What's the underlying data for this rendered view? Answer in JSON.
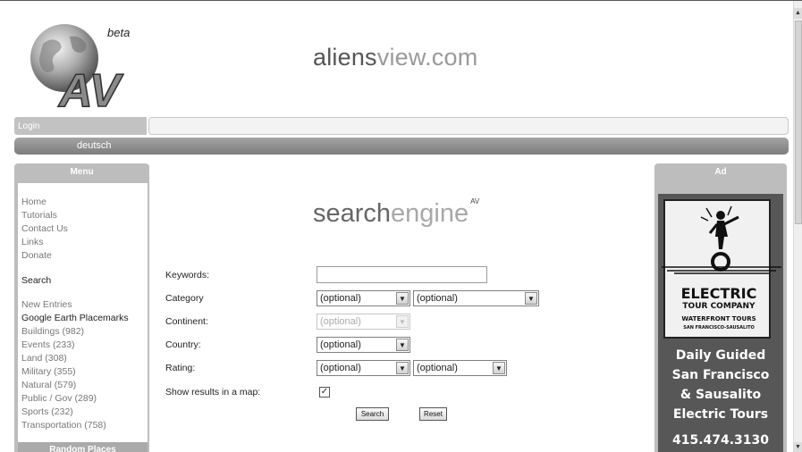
{
  "header": {
    "beta_label": "beta",
    "site_name_bold": "aliens",
    "site_name_light": "view.com",
    "login_label": "Login",
    "language_link": "deutsch"
  },
  "menu": {
    "title": "Menu",
    "links": [
      "Home",
      "Tutorials",
      "Contact Us",
      "Links",
      "Donate"
    ],
    "search_label": "Search",
    "new_entries": "New Entries",
    "placemarks": "Google Earth Placemarks",
    "categories": [
      "Buildings (982)",
      "Events (233)",
      "Land (308)",
      "Military (355)",
      "Natural (579)",
      "Public / Gov (289)",
      "Sports (232)",
      "Transportation (758)"
    ],
    "random_places": "Random Places"
  },
  "search": {
    "logo_bold": "search",
    "logo_light": "engine",
    "logo_sup": "AV",
    "keywords_label": "Keywords:",
    "keywords_value": "",
    "category_label": "Category",
    "category_value": "(optional)",
    "subcategory_value": "(optional)",
    "continent_label": "Continent:",
    "continent_value": "(optional)",
    "country_label": "Country:",
    "country_value": "(optional)",
    "rating_label": "Rating:",
    "rating_value": "(optional)",
    "rating2_value": "(optional)",
    "map_label": "Show results in a map:",
    "map_checked": true,
    "search_button": "Search",
    "reset_button": "Reset"
  },
  "ad": {
    "title": "Ad",
    "brand_line1": "ELECTRIC",
    "brand_line2": "TOUR COMPANY",
    "brand_line3": "WATERFRONT TOURS",
    "brand_line4": "SAN FRANCISCO-SAUSALITO",
    "tagline": [
      "Daily Guided",
      "San Francisco",
      "& Sausalito",
      "Electric Tours"
    ],
    "phone": "415.474.3130"
  },
  "icons": {
    "logo": "globe-logo-icon",
    "checkbox": "check-icon",
    "dropdown": "chevron-down-icon"
  }
}
